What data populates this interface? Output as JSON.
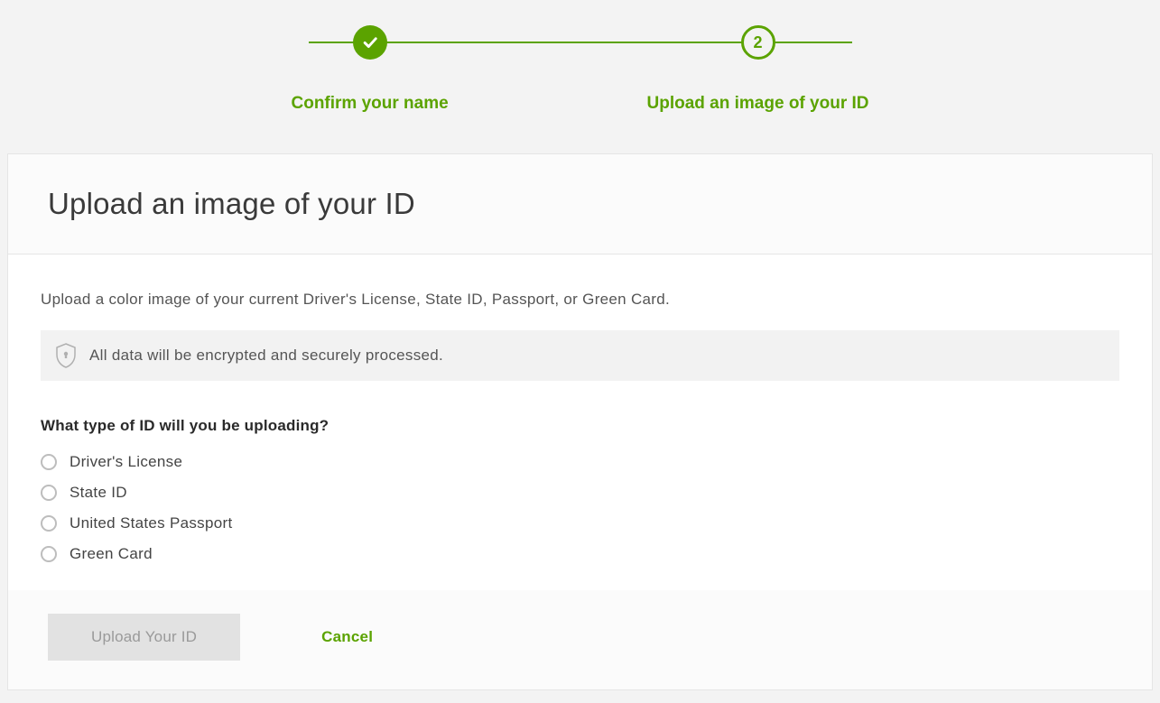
{
  "stepper": {
    "steps": [
      {
        "label": "Confirm your name",
        "state": "completed"
      },
      {
        "label": "Upload an image of your ID",
        "state": "current",
        "number": "2"
      }
    ]
  },
  "page": {
    "title": "Upload an image of your ID",
    "intro": "Upload a color image of your current Driver's License, State ID, Passport, or Green Card.",
    "notice": "All data will be encrypted and securely processed.",
    "question": "What type of ID will you be uploading?"
  },
  "options": [
    {
      "label": "Driver's License"
    },
    {
      "label": "State ID"
    },
    {
      "label": "United States Passport"
    },
    {
      "label": "Green Card"
    }
  ],
  "actions": {
    "primary": "Upload Your ID",
    "cancel": "Cancel"
  }
}
